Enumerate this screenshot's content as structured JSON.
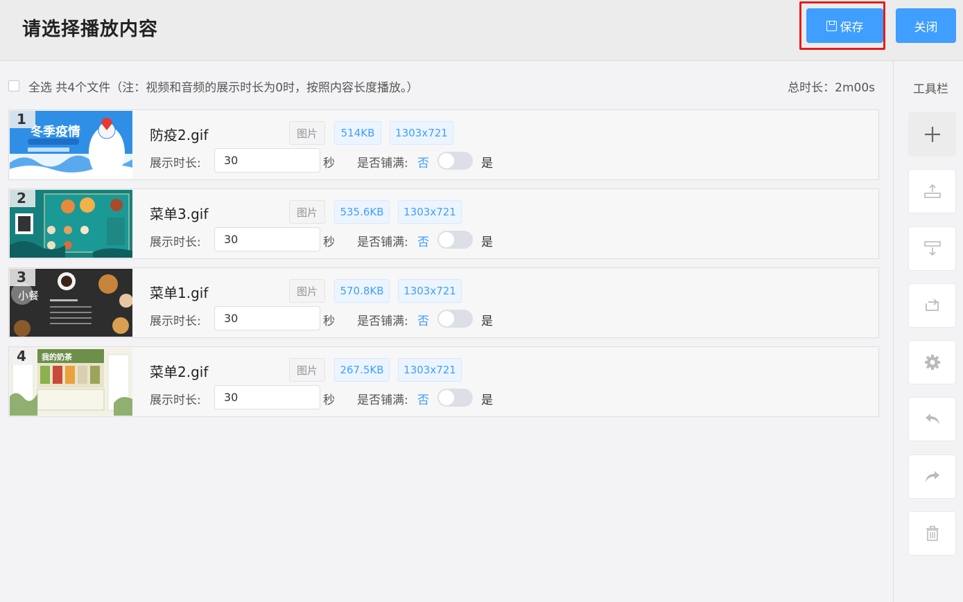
{
  "header": {
    "title": "请选择播放内容",
    "save_label": "保存",
    "close_label": "关闭"
  },
  "select_bar": {
    "label": "全选 共4个文件（注：视频和音频的展示时长为0时，按照内容长度播放。）",
    "total_label": "总时长：2m00s"
  },
  "items": [
    {
      "index": "1",
      "name": "防疫2.gif",
      "type": "图片",
      "size": "514KB",
      "resolution": "1303x721",
      "duration_label": "展示时长:",
      "duration": "30",
      "unit": "秒",
      "fill_label": "是否铺满:",
      "no": "否",
      "yes": "是",
      "thumb_text": "冬季疫情"
    },
    {
      "index": "2",
      "name": "菜单3.gif",
      "type": "图片",
      "size": "535.6KB",
      "resolution": "1303x721",
      "duration_label": "展示时长:",
      "duration": "30",
      "unit": "秒",
      "fill_label": "是否铺满:",
      "no": "否",
      "yes": "是"
    },
    {
      "index": "3",
      "name": "菜单1.gif",
      "type": "图片",
      "size": "570.8KB",
      "resolution": "1303x721",
      "duration_label": "展示时长:",
      "duration": "30",
      "unit": "秒",
      "fill_label": "是否铺满:",
      "no": "否",
      "yes": "是",
      "thumb_text": "小餐"
    },
    {
      "index": "4",
      "name": "菜单2.gif",
      "type": "图片",
      "size": "267.5KB",
      "resolution": "1303x721",
      "duration_label": "展示时长:",
      "duration": "30",
      "unit": "秒",
      "fill_label": "是否铺满:",
      "no": "否",
      "yes": "是",
      "thumb_text": "我的奶茶"
    }
  ],
  "toolbar": {
    "title": "工具栏",
    "buttons": [
      "add-icon",
      "move-up-icon",
      "move-down-icon",
      "loop-icon",
      "gear-icon",
      "undo-icon",
      "redo-icon",
      "trash-icon"
    ]
  },
  "colors": {
    "primary": "#409eff",
    "highlight": "#e8191b"
  }
}
